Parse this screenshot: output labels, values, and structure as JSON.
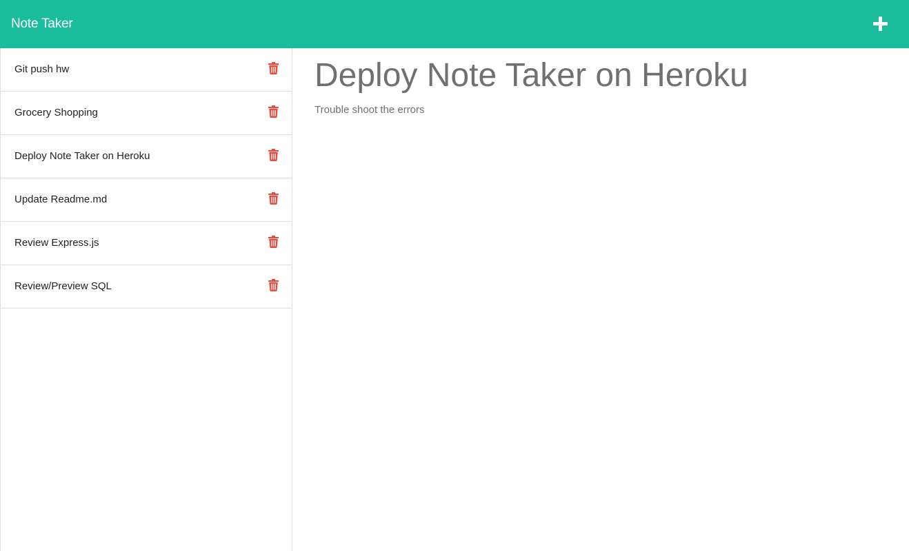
{
  "app": {
    "title": "Note Taker",
    "new_note_icon": "plus-icon"
  },
  "colors": {
    "navbar": "#1abc9c",
    "delete_icon": "#e74c3c",
    "note_text": "#707070"
  },
  "notes": [
    {
      "title": "Git push hw",
      "delete_icon": "trash-icon"
    },
    {
      "title": "Grocery Shopping",
      "delete_icon": "trash-icon"
    },
    {
      "title": "Deploy Note Taker on Heroku",
      "delete_icon": "trash-icon"
    },
    {
      "title": "Update Readme.md",
      "delete_icon": "trash-icon"
    },
    {
      "title": "Review Express.js",
      "delete_icon": "trash-icon"
    },
    {
      "title": "Review/Preview SQL",
      "delete_icon": "trash-icon"
    }
  ],
  "active_note": {
    "title": "Deploy Note Taker on Heroku",
    "text": "Trouble shoot the errors"
  }
}
